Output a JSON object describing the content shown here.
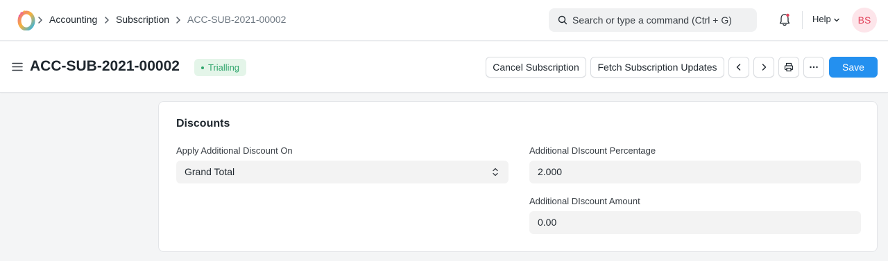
{
  "navbar": {
    "breadcrumbs": [
      {
        "label": "Accounting"
      },
      {
        "label": "Subscription"
      },
      {
        "label": "ACC-SUB-2021-00002"
      }
    ],
    "search": {
      "placeholder": "Search or type a command (Ctrl + G)",
      "value": ""
    },
    "help_label": "Help",
    "avatar_initials": "BS"
  },
  "page": {
    "title": "ACC-SUB-2021-00002",
    "status": "Trialling",
    "actions": {
      "cancel_label": "Cancel Subscription",
      "fetch_label": "Fetch Subscription Updates",
      "save_label": "Save"
    }
  },
  "form": {
    "section_title": "Discounts",
    "apply_discount_on": {
      "label": "Apply Additional Discount On",
      "value": "Grand Total"
    },
    "discount_percentage": {
      "label": "Additional DIscount Percentage",
      "value": "2.000"
    },
    "discount_amount": {
      "label": "Additional DIscount Amount",
      "value": "0.00"
    }
  },
  "colors": {
    "primary": "#2490ef",
    "status_bg": "#e4f5e9",
    "status_text": "#30a66d",
    "avatar_bg": "#fde5ea",
    "avatar_text": "#e2445c"
  },
  "icons": [
    "app-logo-icon",
    "chevron-right-icon",
    "search-icon",
    "bell-icon",
    "chevron-down-icon",
    "hamburger-icon",
    "chevron-left-icon",
    "printer-icon",
    "more-icon",
    "select-updown-icon"
  ]
}
